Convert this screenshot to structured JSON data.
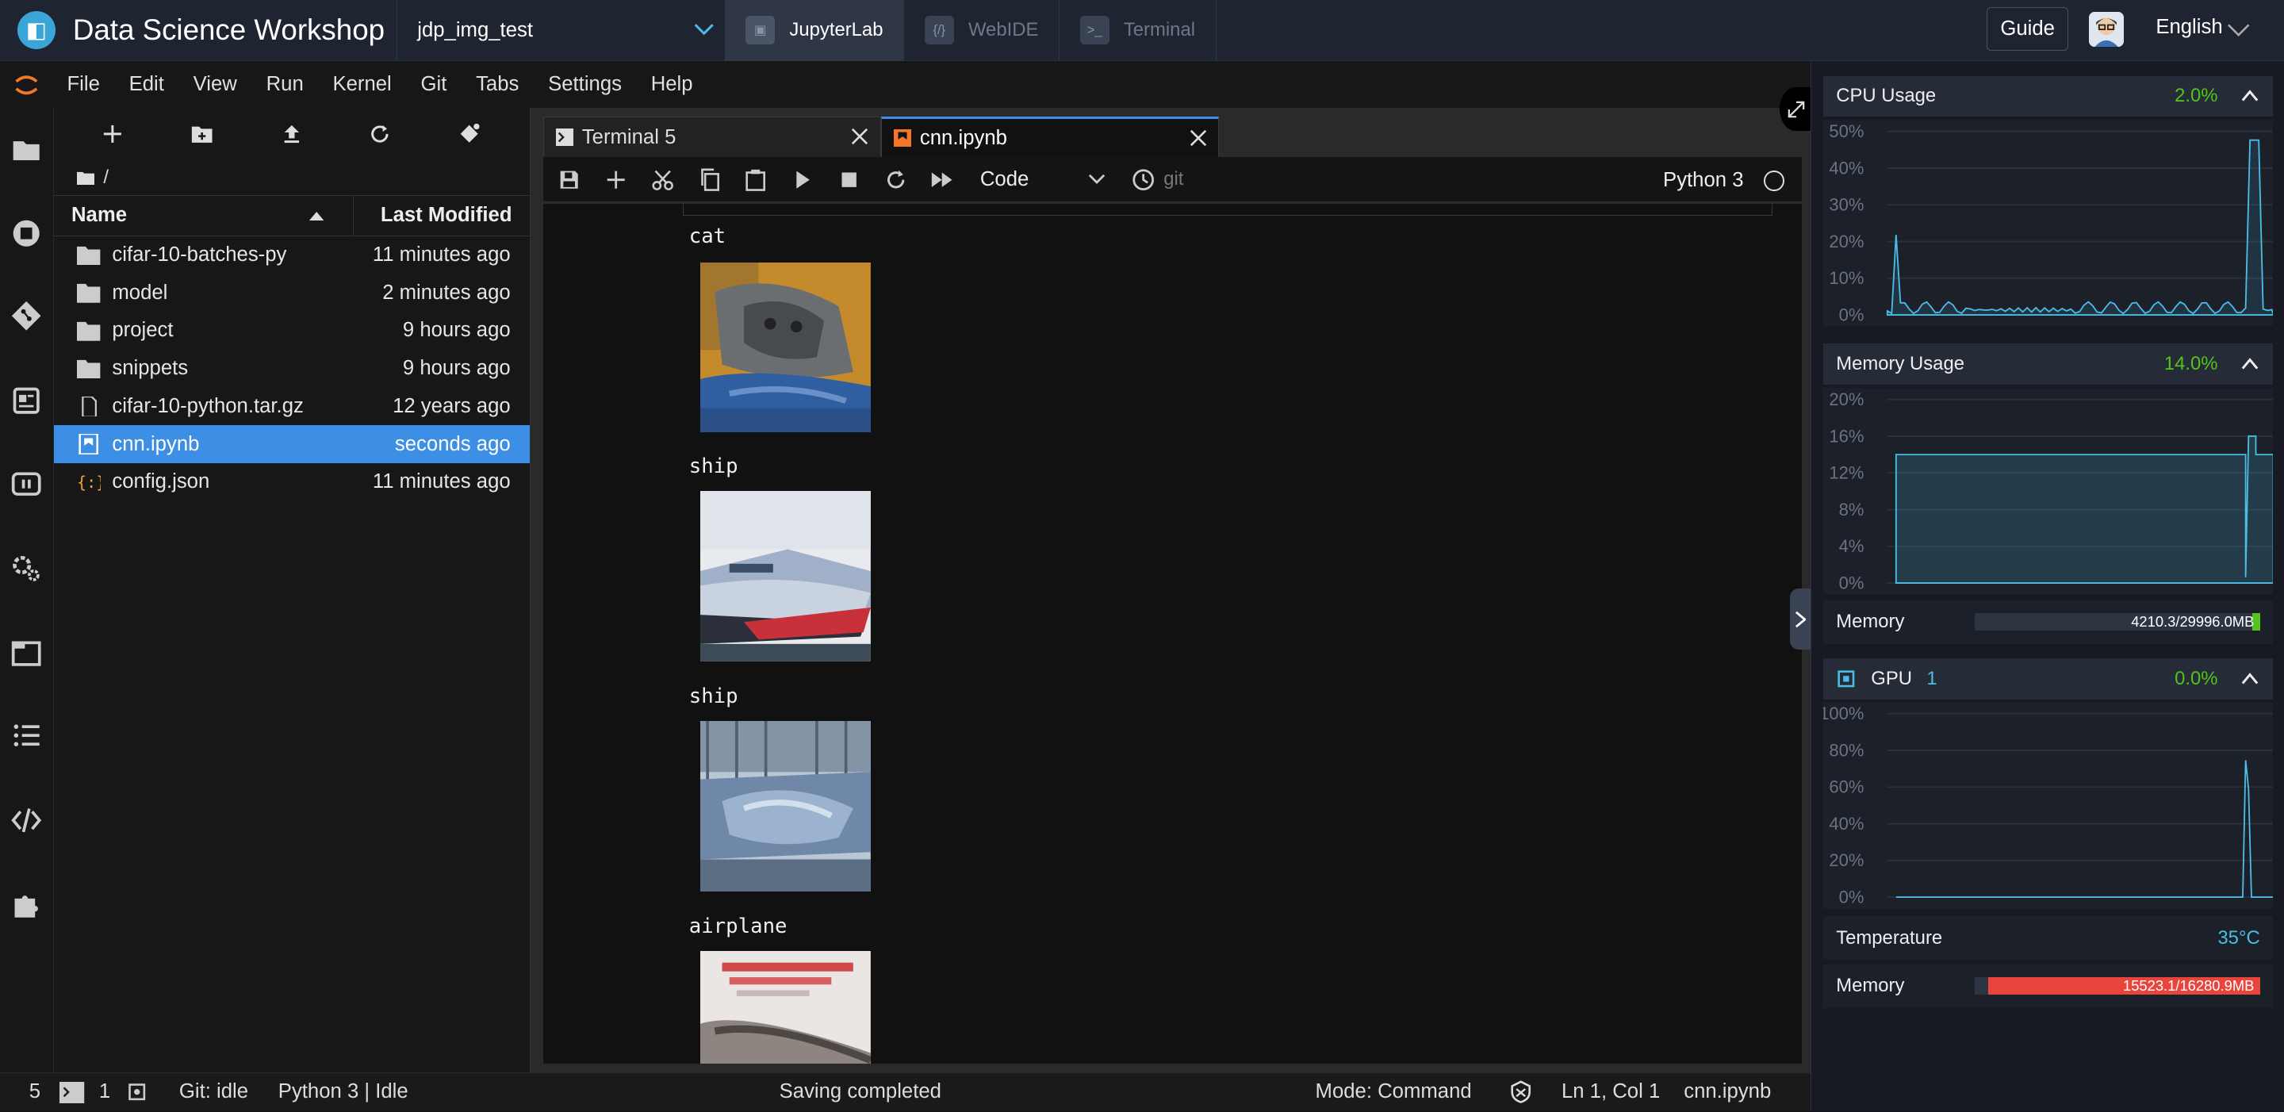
{
  "header": {
    "app_title": "Data Science Workshop",
    "project": "jdp_img_test",
    "tabs": [
      {
        "label": "JupyterLab",
        "active": true
      },
      {
        "label": "WebIDE",
        "active": false
      },
      {
        "label": "Terminal",
        "active": false
      }
    ],
    "guide_label": "Guide",
    "language": "English"
  },
  "menubar": [
    "File",
    "Edit",
    "View",
    "Run",
    "Kernel",
    "Git",
    "Tabs",
    "Settings",
    "Help"
  ],
  "filebrowser": {
    "path": "/",
    "col_name": "Name",
    "col_modified": "Last Modified",
    "files": [
      {
        "name": "cifar-10-batches-py",
        "modified": "11 minutes ago",
        "type": "folder"
      },
      {
        "name": "model",
        "modified": "2 minutes ago",
        "type": "folder"
      },
      {
        "name": "project",
        "modified": "9 hours ago",
        "type": "folder"
      },
      {
        "name": "snippets",
        "modified": "9 hours ago",
        "type": "folder"
      },
      {
        "name": "cifar-10-python.tar.gz",
        "modified": "12 years ago",
        "type": "file"
      },
      {
        "name": "cnn.ipynb",
        "modified": "seconds ago",
        "type": "notebook",
        "selected": true
      },
      {
        "name": "config.json",
        "modified": "11 minutes ago",
        "type": "json"
      }
    ]
  },
  "editor": {
    "tabs": [
      {
        "label": "Terminal 5"
      },
      {
        "label": "cnn.ipynb"
      }
    ],
    "cell_type": "Code",
    "git_label": "git",
    "kernel": "Python 3",
    "outputs": [
      "cat",
      "ship",
      "ship",
      "airplane"
    ]
  },
  "monitor": {
    "cpu": {
      "title": "CPU Usage",
      "value": "2.0%",
      "yticks": [
        "50%",
        "40%",
        "30%",
        "20%",
        "10%",
        "0%"
      ]
    },
    "memory": {
      "title": "Memory Usage",
      "value": "14.0%",
      "yticks": [
        "20%",
        "16%",
        "12%",
        "8%",
        "4%",
        "0%"
      ]
    },
    "memory_row": {
      "label": "Memory",
      "value": "4210.3/29996.0MB",
      "fraction": 0.14
    },
    "gpu": {
      "title": "GPU",
      "count": "1",
      "value": "0.0%",
      "yticks": [
        "100%",
        "80%",
        "60%",
        "40%",
        "20%",
        "0%"
      ]
    },
    "temperature": {
      "label": "Temperature",
      "value": "35°C"
    },
    "gpu_memory": {
      "label": "Memory",
      "value": "15523.1/16280.9MB",
      "fraction": 0.953
    },
    "colors": {
      "line": "#4bbce6",
      "ok": "#52c41a",
      "danger": "#e8453c"
    }
  },
  "statusbar": {
    "count1": "5",
    "count2": "1",
    "git": "Git: idle",
    "kernel_status": "Python 3 | Idle",
    "message": "Saving completed",
    "mode": "Mode: Command",
    "position": "Ln 1, Col 1",
    "filename": "cnn.ipynb"
  }
}
